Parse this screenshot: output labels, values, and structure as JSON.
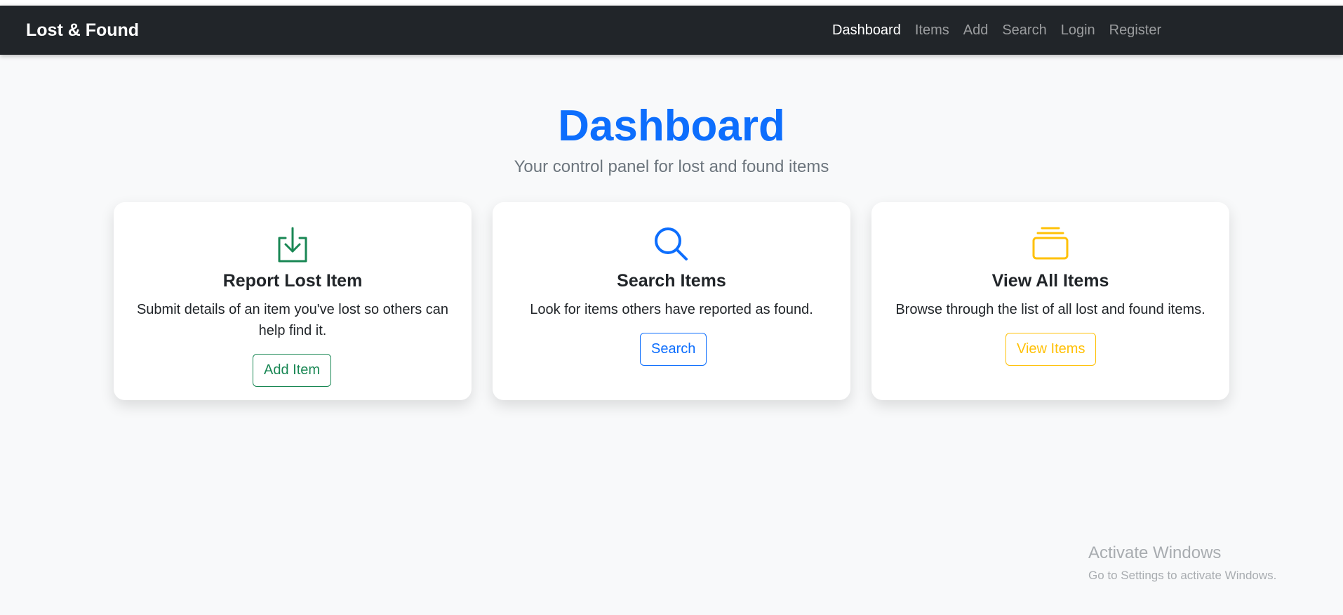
{
  "navbar": {
    "brand": "Lost & Found",
    "links": [
      {
        "label": "Dashboard",
        "active": true
      },
      {
        "label": "Items",
        "active": false
      },
      {
        "label": "Add",
        "active": false
      },
      {
        "label": "Search",
        "active": false
      },
      {
        "label": "Login",
        "active": false
      },
      {
        "label": "Register",
        "active": false
      }
    ]
  },
  "main": {
    "title": "Dashboard",
    "subtitle": "Your control panel for lost and found items"
  },
  "cards": [
    {
      "icon": "download-box-icon",
      "title": "Report Lost Item",
      "text": "Submit details of an item you've lost so others can help find it.",
      "button": "Add Item",
      "color": "#198754"
    },
    {
      "icon": "search-icon",
      "title": "Search Items",
      "text": "Look for items others have reported as found.",
      "button": "Search",
      "color": "#0d6efd"
    },
    {
      "icon": "collection-icon",
      "title": "View All Items",
      "text": "Browse through the list of all lost and found items.",
      "button": "View Items",
      "color": "#ffc107"
    }
  ],
  "watermark": {
    "line1": "Activate Windows",
    "line2": "Go to Settings to activate Windows."
  },
  "colors": {
    "navbar_bg": "#212529",
    "primary": "#0d6efd",
    "success": "#198754",
    "warning": "#ffc107",
    "page_bg": "#f8f9fa"
  }
}
